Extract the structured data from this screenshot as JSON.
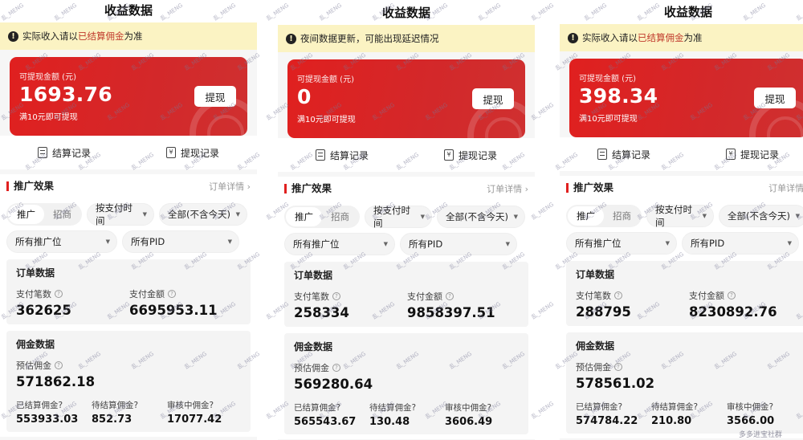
{
  "panels": [
    {
      "title": "收益数据",
      "notice": {
        "pre": "实际收入请以",
        "highlight": "已结算佣金",
        "post": "为准"
      },
      "card": {
        "label": "可提现金额 (元)",
        "amount": "1693.76",
        "min_note": "满10元即可提现",
        "withdraw_button": "提现"
      },
      "records": [
        "结算记录",
        "提现记录"
      ],
      "section": {
        "title": "推广效果",
        "link": "订单详情",
        "tabs": [
          "推广",
          "招商"
        ],
        "select_time": "按支付时间",
        "select_range": "全部(不含今天)",
        "select_position": "所有推广位",
        "select_pid": "所有PID"
      },
      "order": {
        "title": "订单数据",
        "pay_count_label": "支付笔数",
        "pay_count": "362625",
        "pay_amount_label": "支付金额",
        "pay_amount": "6695953.11"
      },
      "commission": {
        "title": "佣金数据",
        "estimate_label": "预估佣金",
        "estimate": "571862.18",
        "settled_label": "已结算佣金",
        "settled": "553933.03",
        "pending_label": "待结算佣金",
        "pending": "852.73",
        "review_label": "审核中佣金",
        "review": "17077.42"
      }
    },
    {
      "title": "收益数据",
      "notice": {
        "pre": "夜间数据更新，可能出现延迟情况",
        "highlight": "",
        "post": ""
      },
      "card": {
        "label": "可提现金额 (元)",
        "amount": "0",
        "min_note": "满10元即可提现",
        "withdraw_button": "提现"
      },
      "records": [
        "结算记录",
        "提现记录"
      ],
      "section": {
        "title": "推广效果",
        "link": "订单详情",
        "tabs": [
          "推广",
          "招商"
        ],
        "select_time": "按支付时间",
        "select_range": "全部(不含今天)",
        "select_position": "所有推广位",
        "select_pid": "所有PID"
      },
      "order": {
        "title": "订单数据",
        "pay_count_label": "支付笔数",
        "pay_count": "258334",
        "pay_amount_label": "支付金额",
        "pay_amount": "9858397.51"
      },
      "commission": {
        "title": "佣金数据",
        "estimate_label": "预估佣金",
        "estimate": "569280.64",
        "settled_label": "已结算佣金",
        "settled": "565543.67",
        "pending_label": "待结算佣金",
        "pending": "130.48",
        "review_label": "审核中佣金",
        "review": "3606.49"
      }
    },
    {
      "title": "收益数据",
      "notice": {
        "pre": "实际收入请以",
        "highlight": "已结算佣金",
        "post": "为准"
      },
      "card": {
        "label": "可提现金额 (元)",
        "amount": "398.34",
        "min_note": "满10元即可提现",
        "withdraw_button": "提现"
      },
      "records": [
        "结算记录",
        "提现记录"
      ],
      "section": {
        "title": "推广效果",
        "link": "订单详情",
        "tabs": [
          "推广",
          "招商"
        ],
        "select_time": "按支付时间",
        "select_range": "全部(不含今天)",
        "select_position": "所有推广位",
        "select_pid": "所有PID"
      },
      "order": {
        "title": "订单数据",
        "pay_count_label": "支付笔数",
        "pay_count": "288795",
        "pay_amount_label": "支付金额",
        "pay_amount": "8230892.76"
      },
      "commission": {
        "title": "佣金数据",
        "estimate_label": "预估佣金",
        "estimate": "578561.02",
        "settled_label": "已结算佣金",
        "settled": "574784.22",
        "pending_label": "待结算佣金",
        "pending": "210.80",
        "review_label": "审核中佣金",
        "review": "3566.00"
      }
    }
  ],
  "watermark": {
    "text": "乱_MENG",
    "footer": "多多进宝社群"
  },
  "colors": {
    "brand_red": "#e0201f",
    "notice_bg": "#fbf3c3",
    "highlight": "#c0392b"
  }
}
